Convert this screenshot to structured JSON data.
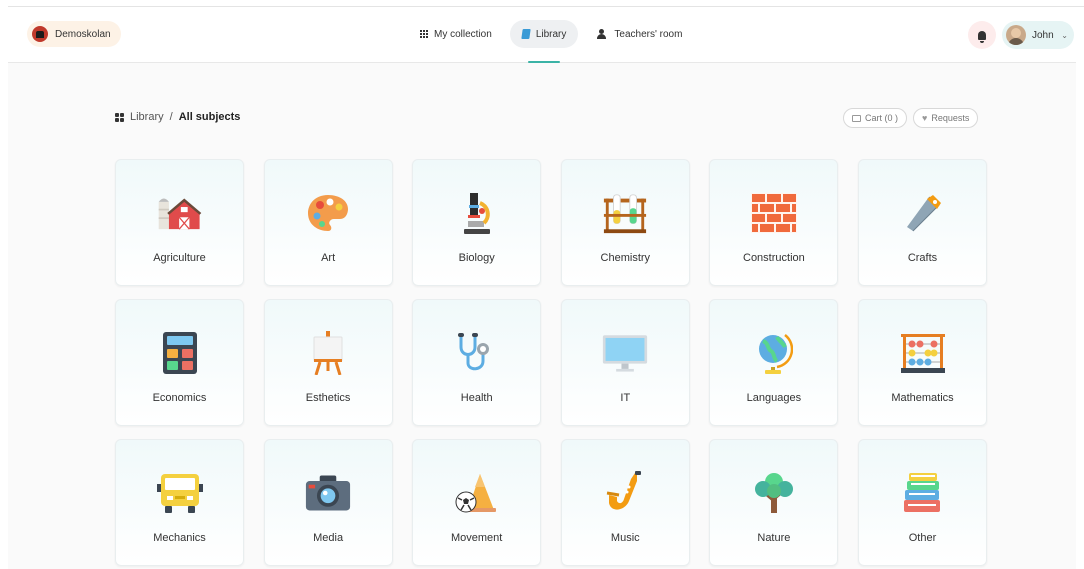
{
  "header": {
    "school": "Demoskolan",
    "nav": [
      {
        "label": "My collection",
        "active": false
      },
      {
        "label": "Library",
        "active": true
      },
      {
        "label": "Teachers' room",
        "active": false
      }
    ],
    "user_name": "John"
  },
  "breadcrumb": {
    "root": "Library",
    "separator": "/",
    "current": "All subjects"
  },
  "actions": {
    "cart": "Cart (0 )",
    "requests": "Requests"
  },
  "subjects": [
    {
      "label": "Agriculture",
      "icon": "barn-icon"
    },
    {
      "label": "Art",
      "icon": "palette-icon"
    },
    {
      "label": "Biology",
      "icon": "microscope-icon"
    },
    {
      "label": "Chemistry",
      "icon": "test-tubes-icon"
    },
    {
      "label": "Construction",
      "icon": "brick-wall-icon"
    },
    {
      "label": "Crafts",
      "icon": "saw-icon"
    },
    {
      "label": "Economics",
      "icon": "calculator-icon"
    },
    {
      "label": "Esthetics",
      "icon": "easel-icon"
    },
    {
      "label": "Health",
      "icon": "stethoscope-icon"
    },
    {
      "label": "IT",
      "icon": "monitor-icon"
    },
    {
      "label": "Languages",
      "icon": "globe-icon"
    },
    {
      "label": "Mathematics",
      "icon": "abacus-icon"
    },
    {
      "label": "Mechanics",
      "icon": "bus-icon"
    },
    {
      "label": "Media",
      "icon": "camera-icon"
    },
    {
      "label": "Movement",
      "icon": "sports-icon"
    },
    {
      "label": "Music",
      "icon": "saxophone-icon"
    },
    {
      "label": "Nature",
      "icon": "tree-icon"
    },
    {
      "label": "Other",
      "icon": "books-icon"
    }
  ]
}
